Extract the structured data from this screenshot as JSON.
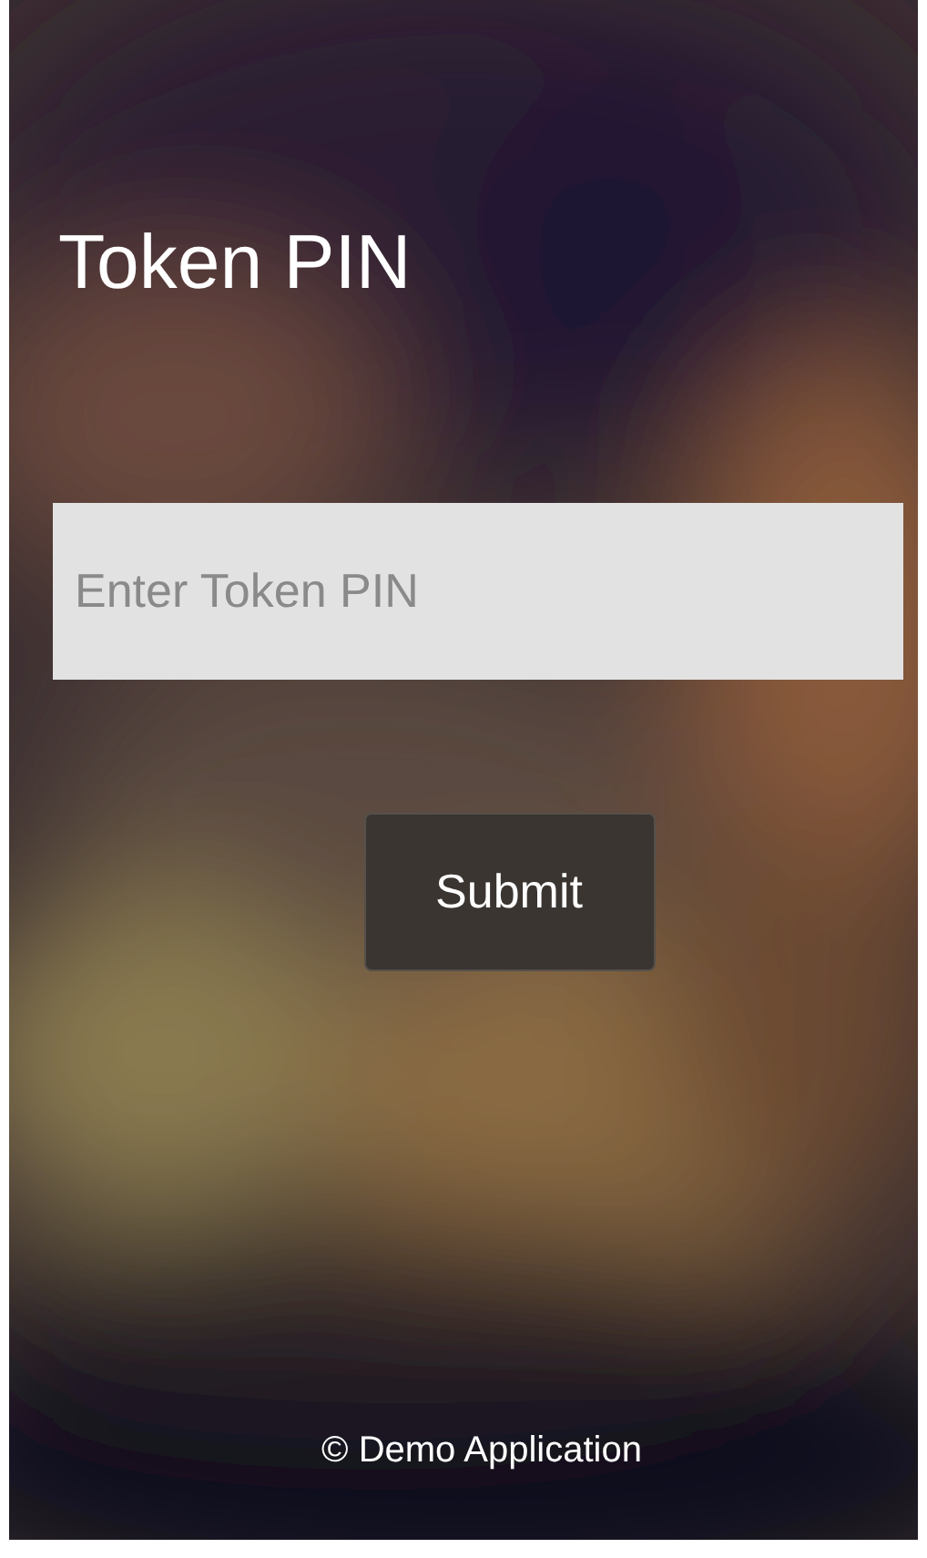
{
  "title": "Token PIN",
  "pin_field": {
    "placeholder": "Enter Token PIN"
  },
  "submit_button": {
    "label": "Submit"
  },
  "footer": "© Demo Application"
}
